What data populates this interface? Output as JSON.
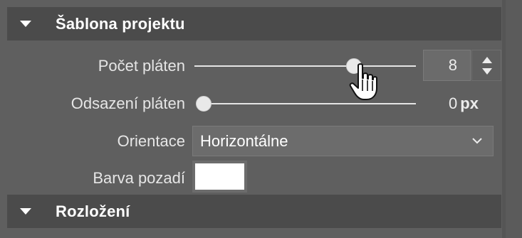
{
  "sections": {
    "template": {
      "title": "Šablona projektu"
    },
    "layout": {
      "title": "Rozložení"
    }
  },
  "fields": {
    "canvas_count": {
      "label": "Počet pláten",
      "value": "8",
      "slider_fraction": 0.72
    },
    "canvas_offset": {
      "label": "Odsazení pláten",
      "value": "0",
      "unit": "px",
      "slider_fraction": 0.0
    },
    "orientation": {
      "label": "Orientace",
      "selected": "Horizontálne"
    },
    "background_color": {
      "label": "Barva pozadí",
      "color": "#ffffff"
    }
  },
  "icons": {
    "section_toggle": "triangle-down-icon",
    "spinner_up": "arrow-up-icon",
    "spinner_down": "arrow-down-icon",
    "select_chevron": "chevron-down-icon",
    "cursor": "hand-pointer-icon"
  }
}
